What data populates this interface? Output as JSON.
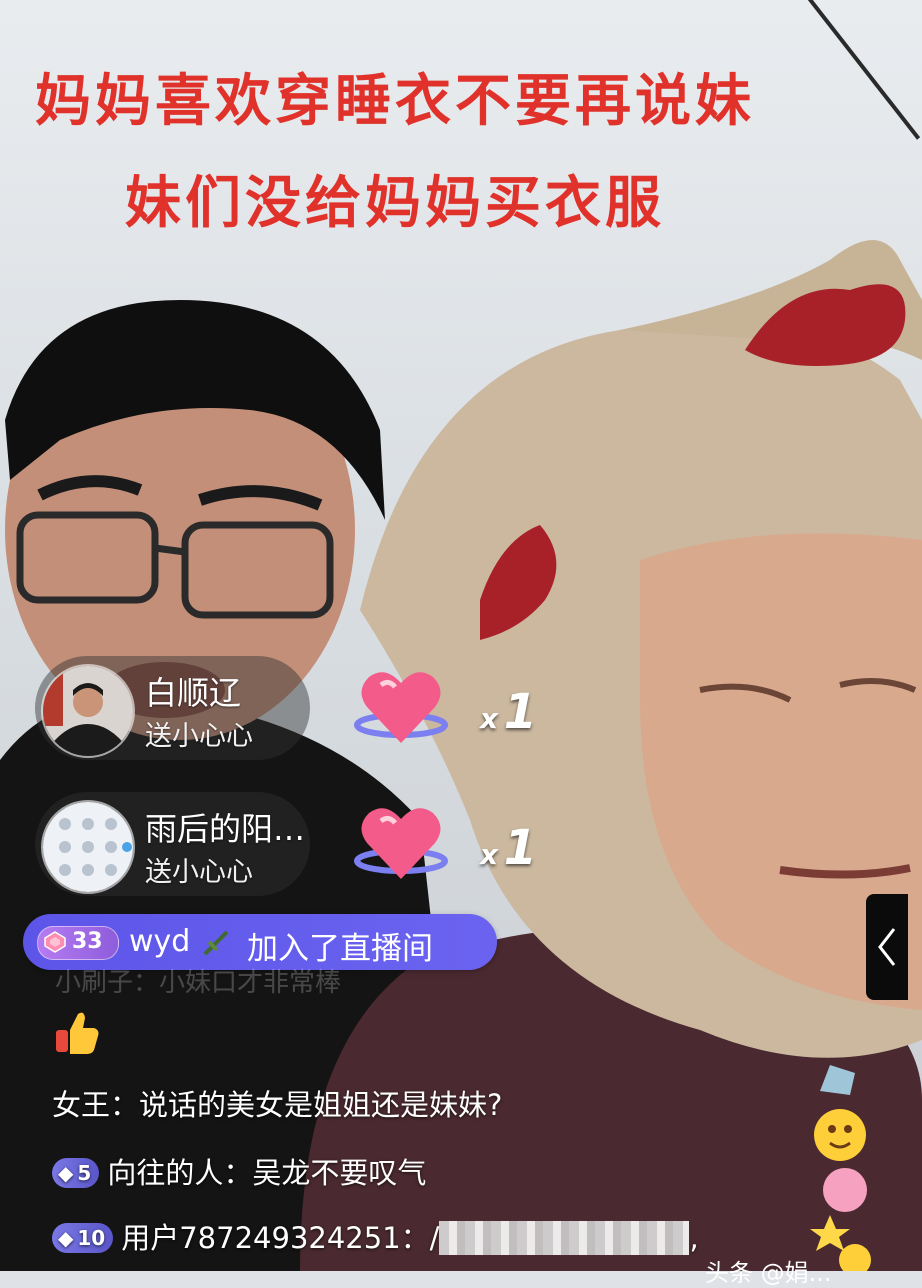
{
  "headline": {
    "line1": "妈妈喜欢穿睡衣不要再说妹",
    "line2": "妹们没给妈妈买衣服"
  },
  "gifts": [
    {
      "user": "白顺辽",
      "action": "送小心心",
      "count_prefix": "x",
      "count": "1"
    },
    {
      "user": "雨后的阳…",
      "action": "送小心心",
      "count_prefix": "x",
      "count": "1"
    }
  ],
  "join": {
    "level": "33",
    "name": "wyd",
    "message": "加入了直播间"
  },
  "faded_comment": "小刷子：小妹口才非常棒",
  "chat": [
    {
      "user": "女王",
      "sep": "：",
      "text": "说话的美女是姐姐还是妹妹?"
    },
    {
      "level": "5",
      "user": "向往的人",
      "sep": "：",
      "text": "吴龙不要叹气"
    },
    {
      "level": "10",
      "user": "用户787249324251",
      "sep": "：",
      "text": "/",
      "tail": ","
    }
  ],
  "side_tab_label": "‹",
  "watermark": "头条 @娟...",
  "colors": {
    "headline": "#e0322b",
    "join_pill": "#5d55e8",
    "level_badge": "#7a78e6"
  }
}
